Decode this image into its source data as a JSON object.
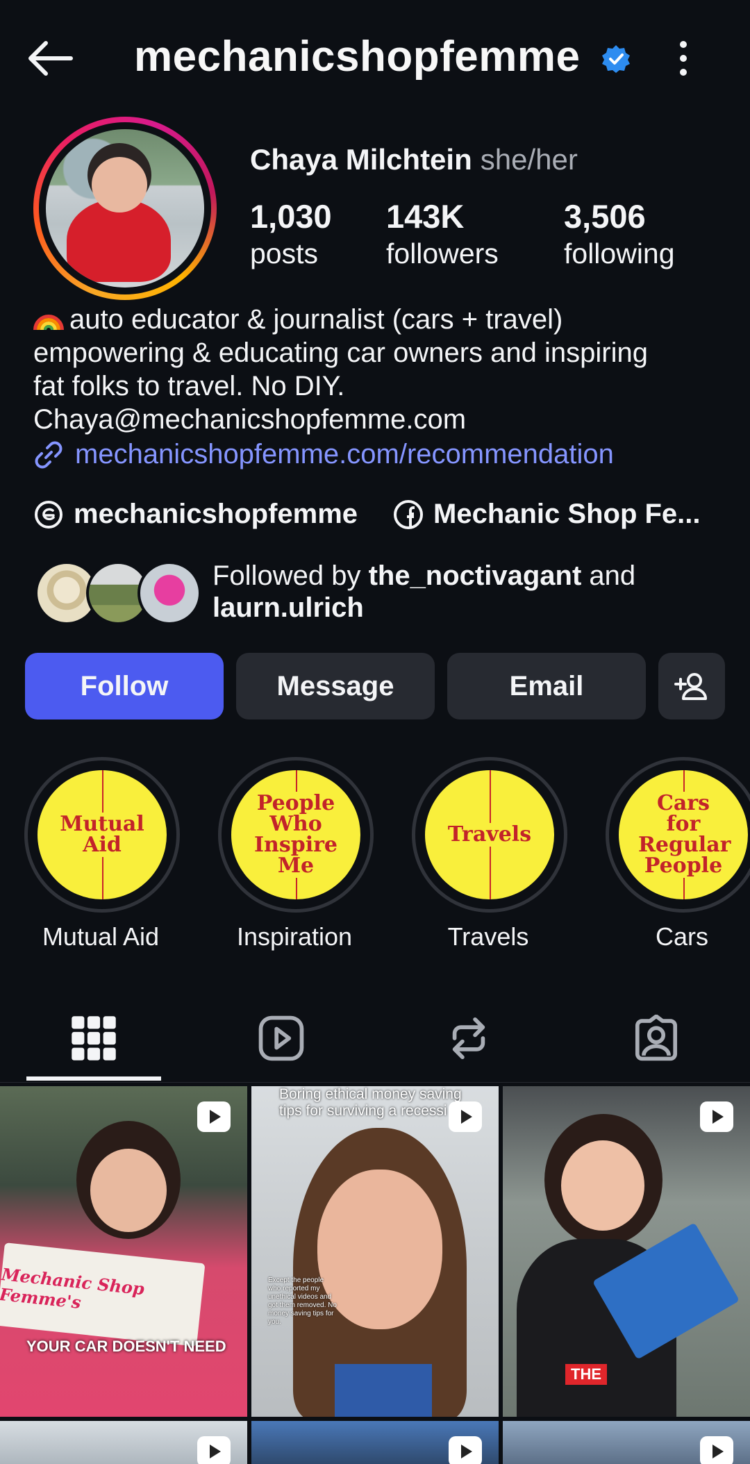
{
  "header": {
    "username": "mechanicshopfemme"
  },
  "profile": {
    "full_name": "Chaya Milchtein",
    "pronouns": "she/her",
    "stats": [
      {
        "value": "1,030",
        "label": "posts"
      },
      {
        "value": "143K",
        "label": "followers"
      },
      {
        "value": "3,506",
        "label": "following"
      }
    ]
  },
  "bio": {
    "line1": "auto educator & journalist (cars + travel)",
    "line2": "empowering & educating car owners and inspiring",
    "line3": "fat folks to travel. No DIY.",
    "line4": "Chaya@mechanicshopfemme.com",
    "link": "mechanicshopfemme.com/recommendation"
  },
  "socials": {
    "threads": "mechanicshopfemme",
    "facebook": "Mechanic Shop Fe..."
  },
  "followed_by": {
    "prefix": "Followed by ",
    "user1": "the_noctivagant",
    "joiner": " and",
    "user2": "laurn.ulrich"
  },
  "actions": {
    "follow": "Follow",
    "message": "Message",
    "email": "Email"
  },
  "highlights": [
    {
      "cover_text": "Mutual Aid",
      "label": "Mutual Aid"
    },
    {
      "cover_text": "People Who Inspire Me",
      "label": "Inspiration"
    },
    {
      "cover_text": "Travels",
      "label": "Travels"
    },
    {
      "cover_text": "Cars for Regular People",
      "label": "Cars"
    }
  ],
  "tabs": [
    "grid-icon",
    "reels-icon",
    "reposts-icon",
    "tagged-icon"
  ],
  "posts": [
    {
      "caption": "YOUR CAR DOESN'T NEED",
      "book_title": "Mechanic Shop Femme's"
    },
    {
      "caption": "Boring ethical money saving tips for surviving a recessi",
      "overlay_text": "Except the people who reported my unethical videos and got them removed. No money saving tips for you."
    },
    {
      "caption": "THE"
    }
  ],
  "colors": {
    "background": "#0c0f14",
    "follow_button": "#4c5bf0",
    "secondary_button": "#272a31",
    "link": "#8595ff",
    "verified": "#2d8cf0",
    "highlight_yellow": "#f9ef3c",
    "highlight_red": "#c2232a"
  }
}
